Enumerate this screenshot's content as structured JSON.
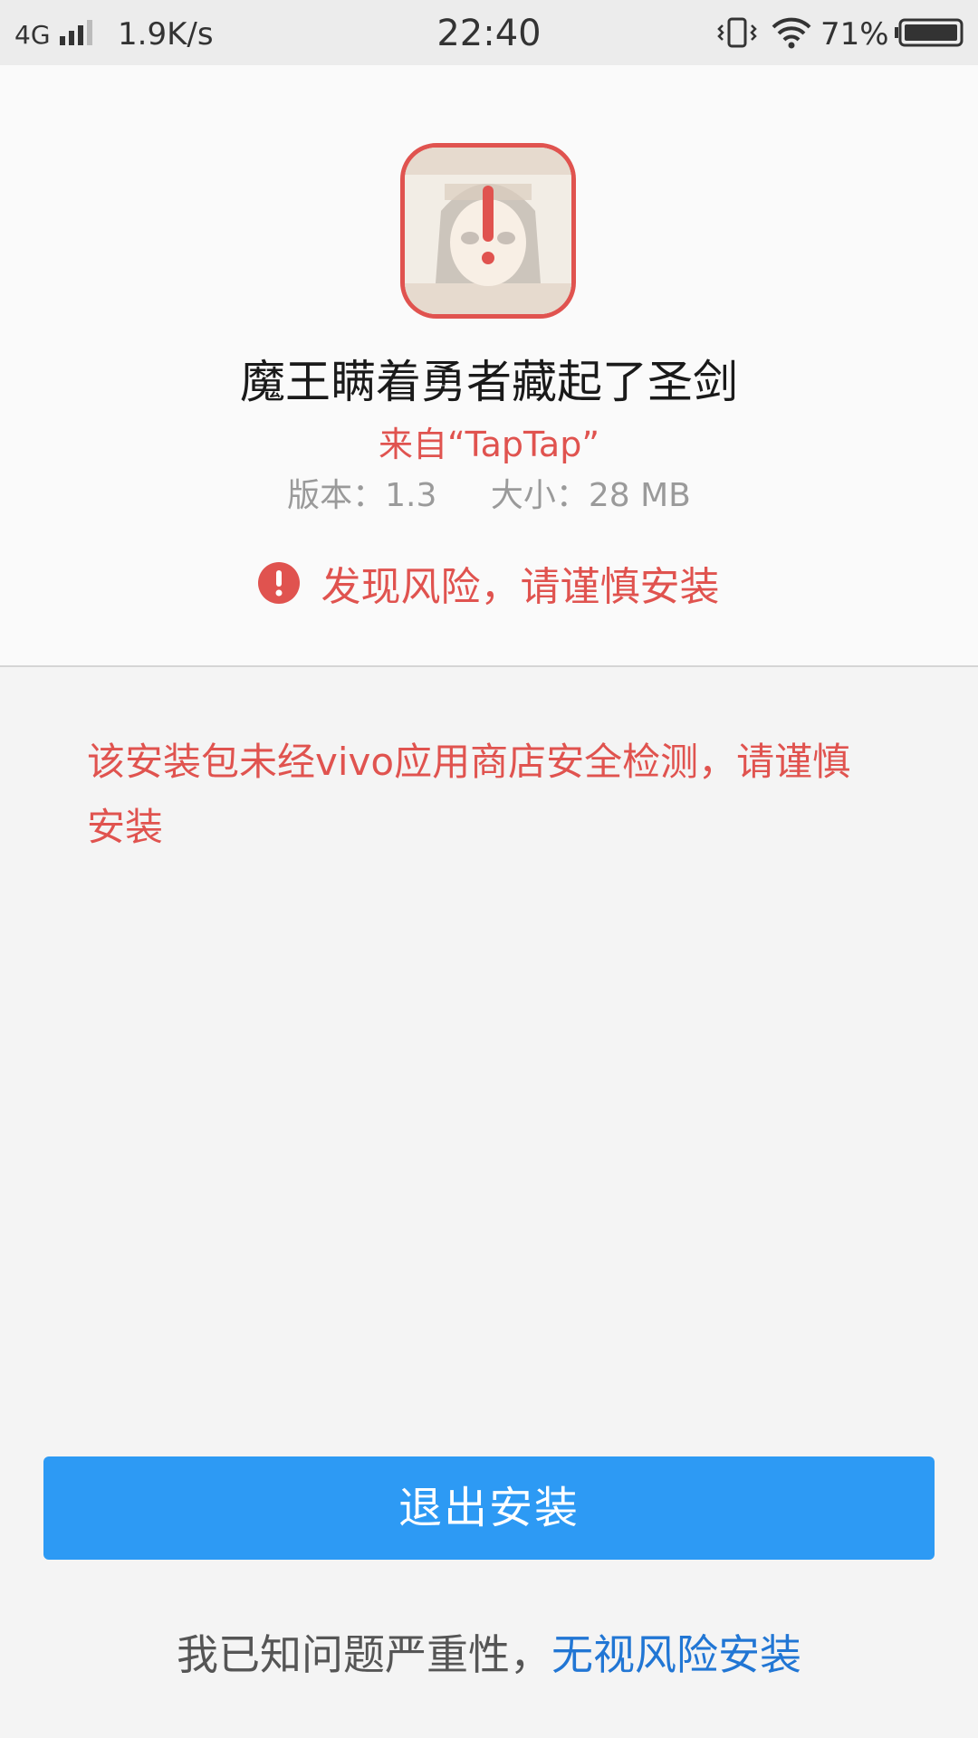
{
  "status_bar": {
    "network": "4G",
    "speed": "1.9K/s",
    "time": "22:40",
    "battery_percent": "71%",
    "icons": [
      "signal-icon",
      "vibrate-icon",
      "wifi-icon",
      "battery-icon"
    ]
  },
  "app": {
    "title": "魔王瞒着勇者藏起了圣剑",
    "source": "来自“TapTap”",
    "version": "版本：1.3",
    "size": "大小：28 MB",
    "icon": "app-icon-with-warning"
  },
  "risk": {
    "text": "发现风险，请谨慎安装",
    "icon": "exclamation-circle-icon"
  },
  "warning_message": "该安装包未经vivo应用商店安全检测，请谨慎安装",
  "actions": {
    "exit_label": "退出安装",
    "acknowledge_text": "我已知问题严重性，",
    "ignore_link": "无视风险安装"
  },
  "colors": {
    "accent_red": "#e0534f",
    "primary_blue": "#2d9af4",
    "link_blue": "#2176d4"
  }
}
